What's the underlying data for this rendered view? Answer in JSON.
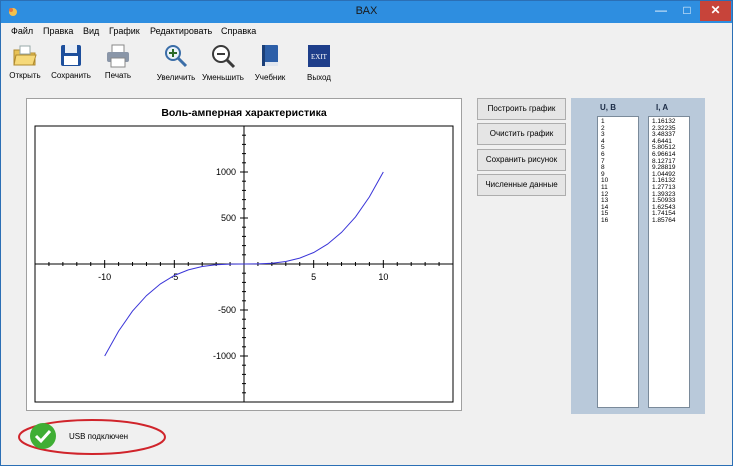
{
  "window": {
    "title": "ВАХ"
  },
  "menu": [
    "Файл",
    "Правка",
    "Вид",
    "График",
    "Редактировать",
    "Справка"
  ],
  "toolbar": [
    {
      "label": "Открыть",
      "icon": "folder-open-icon"
    },
    {
      "label": "Сохранить",
      "icon": "floppy-disk-icon"
    },
    {
      "label": "Печать",
      "icon": "printer-icon"
    },
    {
      "label": "Увеличить",
      "icon": "zoom-in-icon"
    },
    {
      "label": "Уменьшить",
      "icon": "zoom-out-icon"
    },
    {
      "label": "Учебник",
      "icon": "book-icon"
    },
    {
      "label": "Выход",
      "icon": "exit-icon",
      "icon_text": "EXIT"
    }
  ],
  "chart_data": {
    "type": "line",
    "title": "Воль-амперная характеристика",
    "xlabel": "",
    "ylabel": "",
    "xlim": [
      -15,
      15
    ],
    "ylim": [
      -1500,
      1500
    ],
    "x_ticks": [
      -10,
      -5,
      5,
      10
    ],
    "y_ticks": [
      1000,
      500,
      -500,
      -1000
    ],
    "x_tick_labels": [
      "-10",
      "-5",
      "5",
      "10"
    ],
    "y_tick_labels": [
      "1000",
      "500",
      "-500",
      "-1000"
    ],
    "grid": false,
    "series": [
      {
        "x": [
          -10,
          -9,
          -8,
          -7,
          -6,
          -5,
          -4,
          -3,
          -2,
          -1,
          0,
          1,
          2,
          3,
          4,
          5,
          6,
          7,
          8,
          9,
          10
        ],
        "y": [
          -1000,
          -729,
          -512,
          -343,
          -216,
          -125,
          -64,
          -27,
          -8,
          -1,
          0,
          1,
          8,
          27,
          64,
          125,
          216,
          343,
          512,
          729,
          1000
        ],
        "color": "#3a35d8"
      }
    ]
  },
  "buttons": [
    "Построить график",
    "Очистить график",
    "Сохранить рисунок",
    "Численные данные"
  ],
  "data_table": {
    "headers": [
      "U, В",
      "I, A"
    ],
    "u": [
      "1",
      "2",
      "3",
      "4",
      "5",
      "6",
      "7",
      "8",
      "9",
      "10",
      "11",
      "12",
      "13",
      "14",
      "15",
      "16"
    ],
    "i": [
      "1.16132",
      "2.32235",
      "3.48337",
      "4.6441",
      "5.80512",
      "6.96614",
      "8.12717",
      "9.28819",
      "1.04492",
      "1.16132",
      "1.27713",
      "1.39323",
      "1.50933",
      "1.62543",
      "1.74154",
      "1.85764"
    ]
  },
  "status": {
    "text": "USB подключен",
    "icon": "check-icon",
    "highlight_color": "#d0242b"
  },
  "colors": {
    "titlebar": "#2e8ee0",
    "panel": "#b9c9da",
    "close": "#c7443a"
  }
}
